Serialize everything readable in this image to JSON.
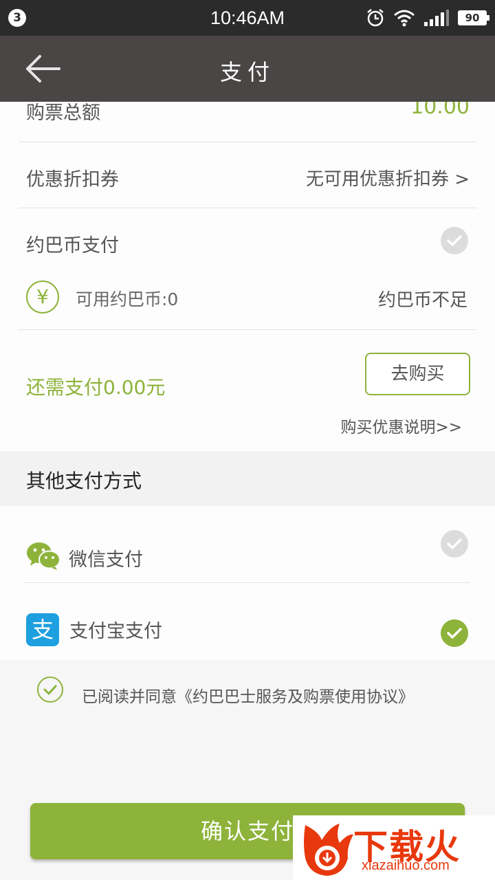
{
  "status_bar": {
    "notification_count": "3",
    "time": "10:46AM",
    "battery": "90",
    "icons": [
      "alarm-icon",
      "wifi-icon",
      "signal-icon",
      "battery-icon"
    ]
  },
  "app_bar": {
    "title": "支付",
    "back_icon": "arrow-left-icon"
  },
  "summary": {
    "total_label": "购票总额",
    "total_value": "10.00",
    "coupon_label": "优惠折扣券",
    "coupon_value": "无可用优惠折扣券 >",
    "coin_label": "约巴币支付",
    "coin_available": "可用约巴币:0",
    "coin_status": "约巴币不足",
    "remaining": "还需支付0.00元",
    "buy_button": "去购买",
    "buy_info_link": "购买优惠说明>>"
  },
  "other_payment": {
    "header": "其他支付方式",
    "methods": [
      {
        "label": "微信支付",
        "icon": "wechat-icon",
        "selected": false
      },
      {
        "label": "支付宝支付",
        "icon": "alipay-icon",
        "icon_glyph": "支",
        "selected": true
      }
    ]
  },
  "agreement": {
    "text": "已阅读并同意《约巴巴士服务及购票使用协议》",
    "checked": true
  },
  "confirm_button": "确认支付",
  "watermark": {
    "brand": "下载火",
    "url": "xiazaihuo.com"
  },
  "colors": {
    "accent": "#8db33a",
    "app_bar": "#4a4646",
    "status_bar": "#2b2b2b",
    "alipay_blue": "#1e9fe0",
    "watermark_red": "#e8380d"
  }
}
